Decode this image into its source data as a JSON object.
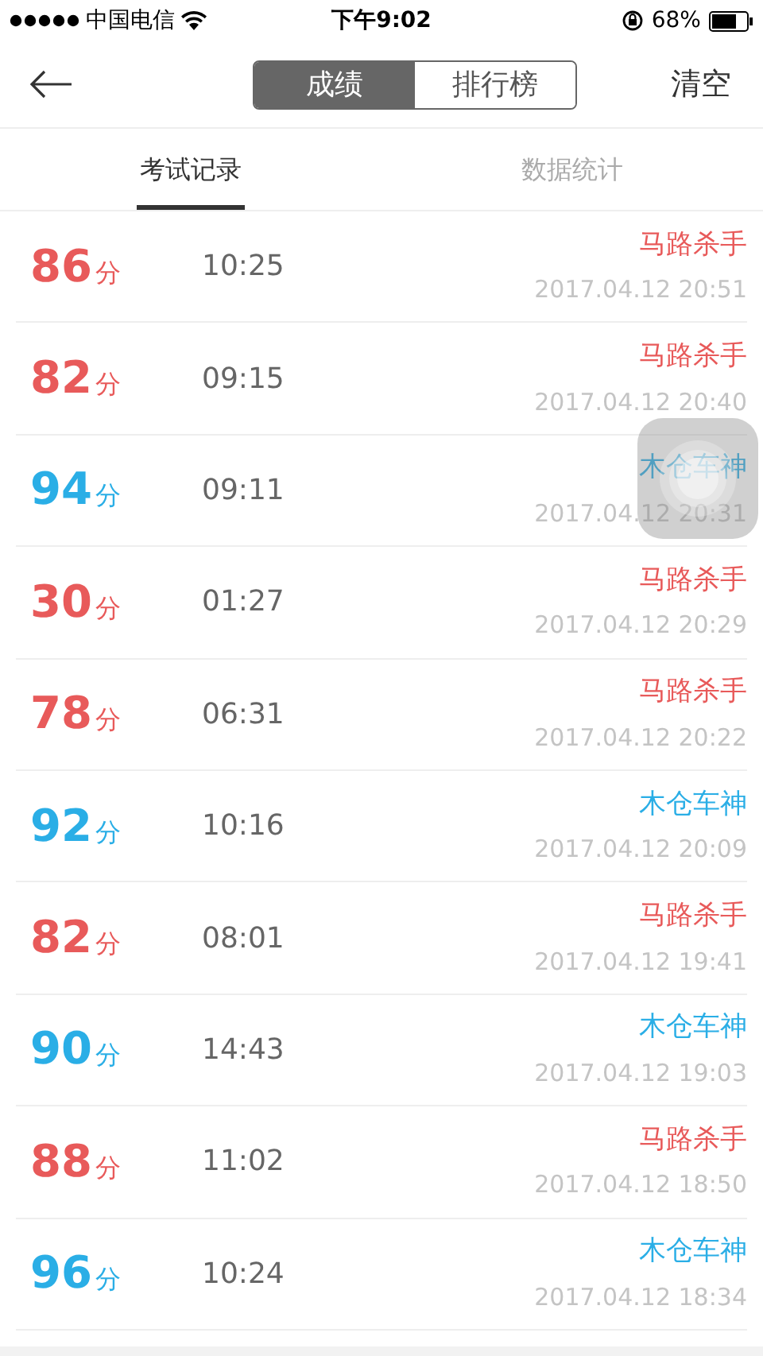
{
  "status_bar": {
    "carrier": "中国电信",
    "time": "下午9:02",
    "battery": "68%"
  },
  "nav": {
    "segments": [
      {
        "label": "成绩",
        "selected": true
      },
      {
        "label": "排行榜",
        "selected": false
      }
    ],
    "action": "清空"
  },
  "tabs": [
    {
      "label": "考试记录",
      "selected": true
    },
    {
      "label": "数据统计",
      "selected": false
    }
  ],
  "records": [
    {
      "score": "86",
      "unit": "分",
      "duration": "10:25",
      "name": "马路杀手",
      "date": "2017.04.12 20:51",
      "color": "#e85a5a"
    },
    {
      "score": "82",
      "unit": "分",
      "duration": "09:15",
      "name": "马路杀手",
      "date": "2017.04.12 20:40",
      "color": "#e85a5a"
    },
    {
      "score": "94",
      "unit": "分",
      "duration": "09:11",
      "name": "木仓车神",
      "date": "2017.04.12 20:31",
      "color": "#2aaee6"
    },
    {
      "score": "30",
      "unit": "分",
      "duration": "01:27",
      "name": "马路杀手",
      "date": "2017.04.12 20:29",
      "color": "#e85a5a"
    },
    {
      "score": "78",
      "unit": "分",
      "duration": "06:31",
      "name": "马路杀手",
      "date": "2017.04.12 20:22",
      "color": "#e85a5a"
    },
    {
      "score": "92",
      "unit": "分",
      "duration": "10:16",
      "name": "木仓车神",
      "date": "2017.04.12 20:09",
      "color": "#2aaee6"
    },
    {
      "score": "82",
      "unit": "分",
      "duration": "08:01",
      "name": "马路杀手",
      "date": "2017.04.12 19:41",
      "color": "#e85a5a"
    },
    {
      "score": "90",
      "unit": "分",
      "duration": "14:43",
      "name": "木仓车神",
      "date": "2017.04.12 19:03",
      "color": "#2aaee6"
    },
    {
      "score": "88",
      "unit": "分",
      "duration": "11:02",
      "name": "马路杀手",
      "date": "2017.04.12 18:50",
      "color": "#e85a5a"
    },
    {
      "score": "96",
      "unit": "分",
      "duration": "10:24",
      "name": "木仓车神",
      "date": "2017.04.12 18:34",
      "color": "#2aaee6"
    }
  ]
}
